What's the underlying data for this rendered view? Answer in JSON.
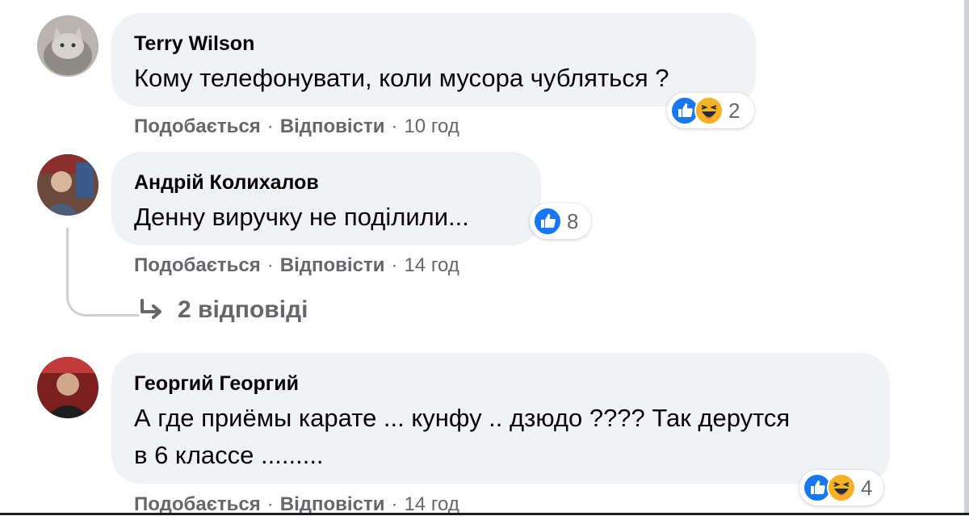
{
  "comments": [
    {
      "author": "Terry Wilson",
      "text": "Кому телефонувати, коли мусора чубляться ?",
      "like": "Подобається",
      "reply": "Відповісти",
      "time": "10 год",
      "reactions": [
        "like",
        "haha"
      ],
      "reaction_count": "2"
    },
    {
      "author": "Андрій Колихалов",
      "text": "Денну виручку не поділили...",
      "like": "Подобається",
      "reply": "Відповісти",
      "time": "14 год",
      "reactions": [
        "like"
      ],
      "reaction_count": "8",
      "replies_label": "2 відповіді"
    },
    {
      "author": "Георгий Георгий",
      "text_line1": "А где приёмы карате ... кунфу .. дзюдо ???? Так дерутся",
      "text_line2": "в 6 классе .........",
      "like": "Подобається",
      "reply": "Відповісти",
      "time": "14 год",
      "reactions": [
        "like",
        "haha"
      ],
      "reaction_count": "4"
    }
  ],
  "separator": "·",
  "colors": {
    "bubble": "#f0f2f5",
    "meta_text": "#65676b",
    "like_blue": "#1877f2",
    "haha_yellow": "#f7b125"
  }
}
